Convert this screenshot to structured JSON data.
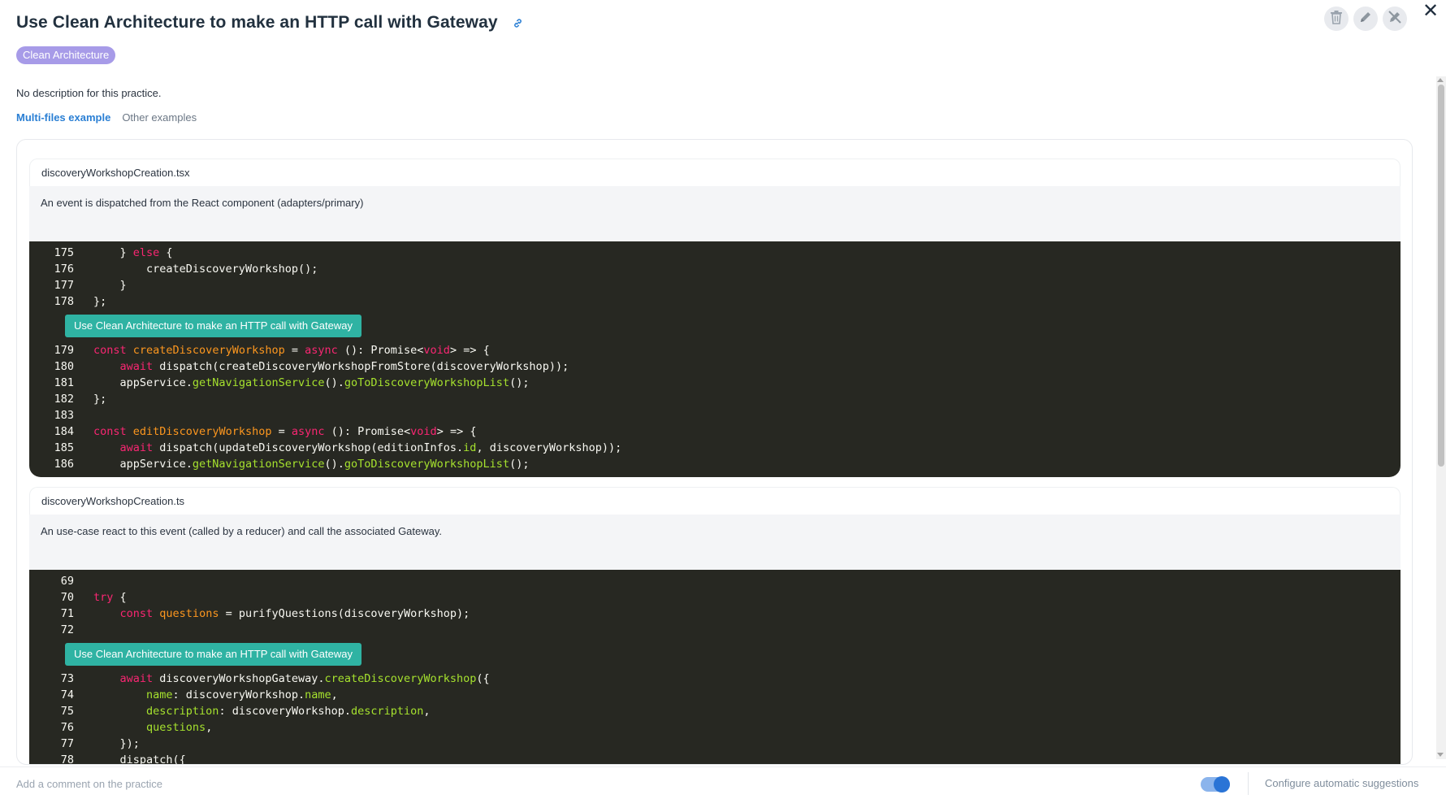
{
  "header": {
    "title": "Use Clean Architecture to make an HTTP call with Gateway"
  },
  "tag": "Clean Architecture",
  "description": "No description for this practice.",
  "tabs": [
    {
      "label": "Multi-files example"
    },
    {
      "label": "Other examples"
    }
  ],
  "files": [
    {
      "name": "discoveryWorkshopCreation.tsx",
      "note": "An event is dispatched from the React component (adapters/primary)",
      "badge": "Use Clean Architecture to make an HTTP call with Gateway"
    },
    {
      "name": "discoveryWorkshopCreation.ts",
      "note": "An use-case react to this event (called by a reducer) and call the associated Gateway.",
      "badge": "Use Clean Architecture to make an HTTP call with Gateway"
    }
  ],
  "footer": {
    "comment_placeholder": "Add a comment on the practice",
    "toggle_on": true,
    "config_label": "Configure automatic suggestions"
  },
  "icons": {
    "link": "link-icon",
    "delete": "trash-icon",
    "edit": "pencil-icon",
    "disable": "pencil-off-icon",
    "close": "close-icon"
  },
  "colors": {
    "tag": "#a79be8",
    "link": "#2a7fd4",
    "code_bg": "#272822",
    "badge": "#2fb3a3",
    "toggle": "#2a74d6"
  }
}
